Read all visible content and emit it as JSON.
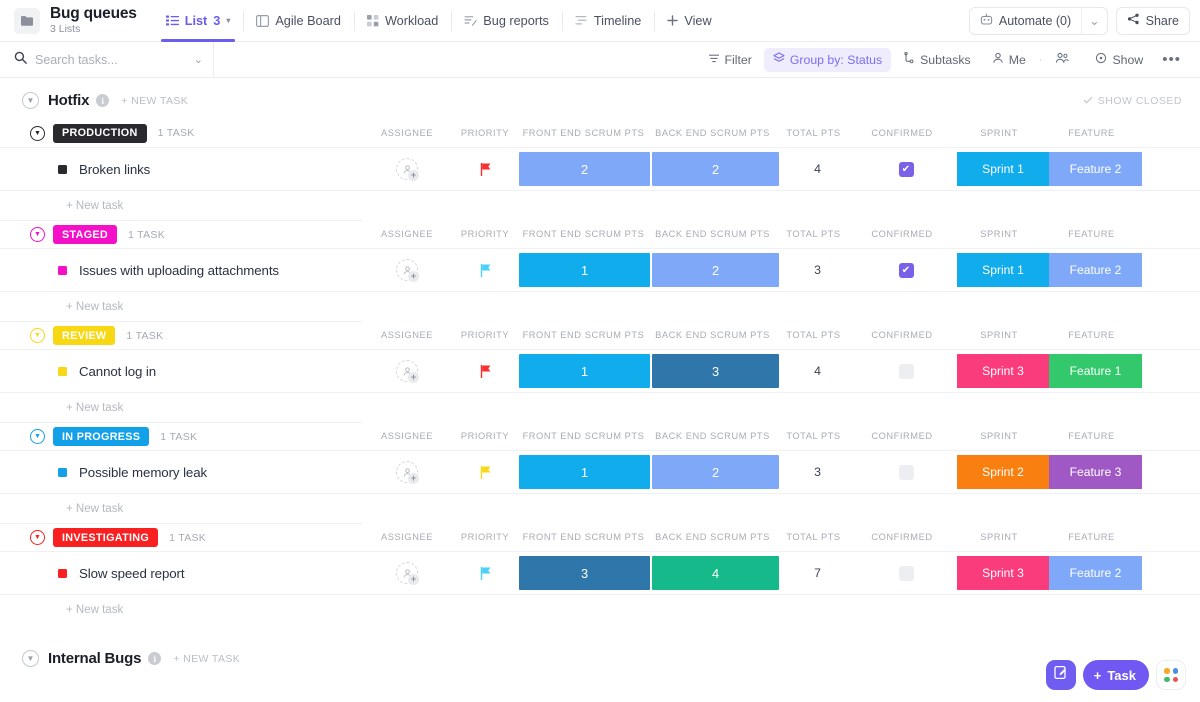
{
  "header": {
    "folder_icon": "folder-icon",
    "title": "Bug queues",
    "subtitle": "3 Lists",
    "tabs": [
      {
        "label": "List",
        "icon": "list-icon",
        "count": "3",
        "caret": "▾",
        "active": true
      },
      {
        "label": "Agile Board",
        "icon": "board-icon",
        "active": false
      },
      {
        "label": "Workload",
        "icon": "workload-icon",
        "active": false
      },
      {
        "label": "Bug reports",
        "icon": "bug-reports-icon",
        "active": false
      },
      {
        "label": "Timeline",
        "icon": "timeline-icon",
        "active": false
      },
      {
        "label": "View",
        "icon": "plus-icon",
        "active": false
      }
    ],
    "automate_label": "Automate (0)",
    "automate_icon": "robot-icon",
    "automate_caret": "⌄",
    "share_label": "Share",
    "share_icon": "share-icon"
  },
  "filterbar": {
    "search_placeholder": "Search tasks...",
    "search_value": "",
    "search_icon": "search-icon",
    "search_caret": "⌄",
    "buttons": [
      {
        "label": "Filter",
        "icon": "filter-icon",
        "highlight": false
      },
      {
        "label": "Group by: Status",
        "icon": "layers-icon",
        "highlight": true
      },
      {
        "label": "Subtasks",
        "icon": "subtask-icon",
        "highlight": false
      },
      {
        "label": "Me",
        "icon": "person-icon",
        "highlight": false
      },
      {
        "label": "",
        "icon": "people-icon",
        "highlight": false
      },
      {
        "label": "Show",
        "icon": "eye-icon",
        "highlight": false
      },
      {
        "label": "•••",
        "icon": "more-icon",
        "highlight": false
      }
    ]
  },
  "groups": [
    {
      "name": "Hotfix",
      "info_icon": "info-icon",
      "new_task_label": "+ NEW TASK",
      "show_closed_label": "SHOW CLOSED",
      "show_closed_icon": "check-icon",
      "columns": [
        "ASSIGNEE",
        "PRIORITY",
        "FRONT END SCRUM PTS",
        "BACK END SCRUM PTS",
        "TOTAL PTS",
        "CONFIRMED",
        "SPRINT",
        "FEATURE"
      ],
      "new_task_row_label": "+ New task",
      "statuses": [
        {
          "label": "PRODUCTION",
          "color": "#2a2a2e",
          "task_count": "1 TASK",
          "task": {
            "name": "Broken links",
            "bullet_color": "#2a2a2e",
            "assignee": "",
            "priority_flag_color": "#fa2f2f",
            "front_end_pts": "2",
            "front_end_color": "#7fa9f8",
            "back_end_pts": "2",
            "back_end_color": "#7fa9f8",
            "total_pts": "4",
            "confirmed": true,
            "sprint": "Sprint 1",
            "sprint_color": "#10acec",
            "feature": "Feature 2",
            "feature_color": "#7fa9f8"
          }
        },
        {
          "label": "STAGED",
          "color": "#f410c8",
          "task_count": "1 TASK",
          "task": {
            "name": "Issues with uploading attachments",
            "bullet_color": "#f410c8",
            "assignee": "",
            "priority_flag_color": "#49d2f8",
            "front_end_pts": "1",
            "front_end_color": "#10acec",
            "back_end_pts": "2",
            "back_end_color": "#7fa9f8",
            "total_pts": "3",
            "confirmed": true,
            "sprint": "Sprint 1",
            "sprint_color": "#10acec",
            "feature": "Feature 2",
            "feature_color": "#7fa9f8"
          }
        },
        {
          "label": "REVIEW",
          "color": "#f8d714",
          "task_count": "1 TASK",
          "task": {
            "name": "Cannot log in",
            "bullet_color": "#f8d714",
            "assignee": "",
            "priority_flag_color": "#fa2f2f",
            "front_end_pts": "1",
            "front_end_color": "#10acec",
            "back_end_pts": "3",
            "back_end_color": "#2f77ab",
            "total_pts": "4",
            "confirmed": false,
            "sprint": "Sprint 3",
            "sprint_color": "#fa3c7d",
            "feature": "Feature 1",
            "feature_color": "#33c86b"
          }
        },
        {
          "label": "IN PROGRESS",
          "color": "#12a1e8",
          "task_count": "1 TASK",
          "task": {
            "name": "Possible memory leak",
            "bullet_color": "#12a1e8",
            "assignee": "",
            "priority_flag_color": "#f8d714",
            "front_end_pts": "1",
            "front_end_color": "#10acec",
            "back_end_pts": "2",
            "back_end_color": "#7fa9f8",
            "total_pts": "3",
            "confirmed": false,
            "sprint": "Sprint 2",
            "sprint_color": "#f98010",
            "feature": "Feature 3",
            "feature_color": "#a059c4"
          }
        },
        {
          "label": "INVESTIGATING",
          "color": "#f82020",
          "task_count": "1 TASK",
          "task": {
            "name": "Slow speed report",
            "bullet_color": "#f82020",
            "assignee": "",
            "priority_flag_color": "#49d2f8",
            "front_end_pts": "3",
            "front_end_color": "#2f77ab",
            "back_end_pts": "4",
            "back_end_color": "#16b98a",
            "total_pts": "7",
            "confirmed": false,
            "sprint": "Sprint 3",
            "sprint_color": "#fa3c7d",
            "feature": "Feature 2",
            "feature_color": "#7fa9f8"
          }
        }
      ]
    },
    {
      "name": "Internal Bugs",
      "info_icon": "info-icon",
      "new_task_label": "+ NEW TASK"
    }
  ],
  "fabs": {
    "note_icon": "note-pencil-icon",
    "task_label": "Task",
    "task_plus": "+",
    "apps_icon": "apps-grid-icon",
    "apps_colors": [
      "#f9a825",
      "#4a90e2",
      "#43b96a",
      "#e8534f"
    ]
  }
}
